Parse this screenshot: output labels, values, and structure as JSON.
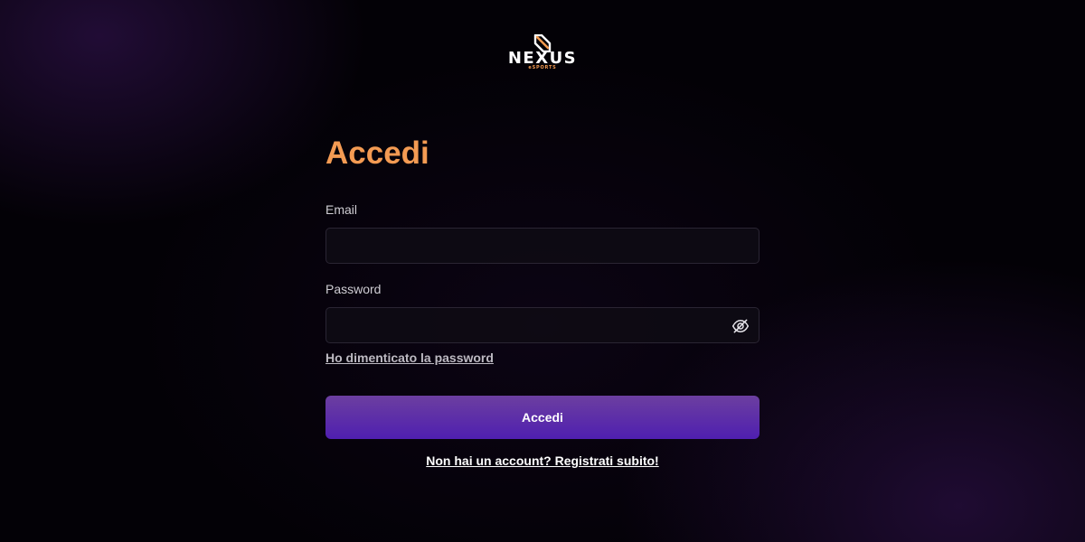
{
  "brand": {
    "name": "NEXUS",
    "tagline": "eSPORTS",
    "logo_icon": "nexus-logo-icon",
    "accent_color": "#f49b53"
  },
  "login": {
    "title": "Accedi",
    "email": {
      "label": "Email",
      "value": "",
      "placeholder": ""
    },
    "password": {
      "label": "Password",
      "value": "",
      "placeholder": "",
      "toggle_icon": "eye-off-icon"
    },
    "forgot_password_link": "Ho dimenticato la password",
    "submit_label": "Accedi",
    "submit_color": "#5a2ab0",
    "register_link": "Non hai un account? Registrati subito!"
  }
}
